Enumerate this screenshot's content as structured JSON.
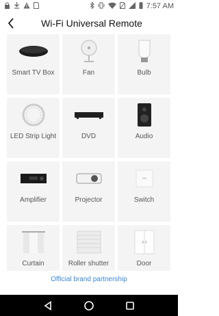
{
  "status_bar": {
    "time": "7:57 AM",
    "left_icons": [
      "lock-icon",
      "download-icon",
      "warning-icon",
      "sim-icon"
    ],
    "right_icons": [
      "bluetooth-icon",
      "vibrate-icon",
      "wifi-icon",
      "no-sim-icon",
      "signal-icon",
      "battery-icon"
    ]
  },
  "header": {
    "back_icon": "back-arrow-icon",
    "title": "Wi-Fi Universal Remote"
  },
  "devices": [
    {
      "label": "Smart TV Box",
      "icon": "tv-box-icon"
    },
    {
      "label": "Fan",
      "icon": "fan-icon"
    },
    {
      "label": "Bulb",
      "icon": "bulb-icon"
    },
    {
      "label": "LED Strip Light",
      "icon": "led-strip-icon"
    },
    {
      "label": "DVD",
      "icon": "dvd-icon"
    },
    {
      "label": "Audio",
      "icon": "audio-icon"
    },
    {
      "label": "Amplifier",
      "icon": "amplifier-icon"
    },
    {
      "label": "Projector",
      "icon": "projector-icon"
    },
    {
      "label": "Switch",
      "icon": "switch-icon"
    },
    {
      "label": "Curtain",
      "icon": "curtain-icon"
    },
    {
      "label": "Roller shutter",
      "icon": "roller-shutter-icon"
    },
    {
      "label": "Door",
      "icon": "door-icon"
    }
  ],
  "footer": {
    "link": "Official brand partnership",
    "link_color": "#3a87d6"
  },
  "nav_bar": {
    "buttons": [
      "back-triangle-icon",
      "home-circle-icon",
      "recents-square-icon"
    ]
  }
}
